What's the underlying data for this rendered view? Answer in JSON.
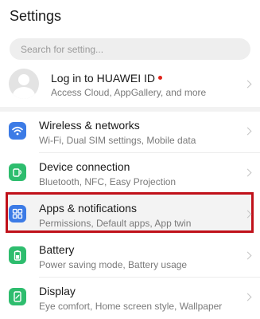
{
  "header": {
    "title": "Settings"
  },
  "search": {
    "placeholder": "Search for setting..."
  },
  "account": {
    "title": "Log in to HUAWEI ID",
    "subtitle": "Access Cloud, AppGallery, and more",
    "has_notification_dot": true
  },
  "colors": {
    "wireless_icon": "#3c7be6",
    "device_icon": "#2ebd6e",
    "apps_icon": "#3c7be6",
    "battery_icon": "#2ebd6e",
    "display_icon": "#2ebd6e",
    "highlight_border": "#c0111a",
    "notification_dot": "#e0241b"
  },
  "items": [
    {
      "label": "Wireless & networks",
      "sub": "Wi-Fi, Dual SIM settings, Mobile data",
      "icon": "wifi-icon"
    },
    {
      "label": "Device connection",
      "sub": "Bluetooth, NFC, Easy Projection",
      "icon": "device-connection-icon"
    },
    {
      "label": "Apps & notifications",
      "sub": "Permissions, Default apps, App twin",
      "icon": "apps-grid-icon"
    },
    {
      "label": "Battery",
      "sub": "Power saving mode, Battery usage",
      "icon": "battery-icon"
    },
    {
      "label": "Display",
      "sub": "Eye comfort, Home screen style, Wallpaper",
      "icon": "display-icon"
    }
  ]
}
